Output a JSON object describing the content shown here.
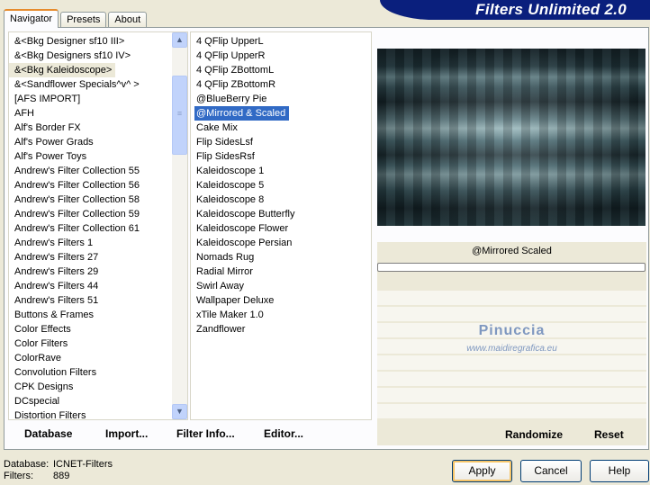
{
  "tabs": [
    "Navigator",
    "Presets",
    "About"
  ],
  "app_title": "Filters Unlimited 2.0",
  "categories": [
    "&<Bkg Designer sf10 III>",
    "&<Bkg Designers sf10 IV>",
    "&<Bkg Kaleidoscope>",
    "&<Sandflower Specials^v^ >",
    "[AFS IMPORT]",
    "AFH",
    "Alf's Border FX",
    "Alf's Power Grads",
    "Alf's Power Toys",
    "Andrew's Filter Collection 55",
    "Andrew's Filter Collection 56",
    "Andrew's Filter Collection 58",
    "Andrew's Filter Collection 59",
    "Andrew's Filter Collection 61",
    "Andrew's Filters 1",
    "Andrew's Filters 27",
    "Andrew's Filters 29",
    "Andrew's Filters 44",
    "Andrew's Filters 51",
    "Buttons & Frames",
    "Color Effects",
    "Color Filters",
    "ColorRave",
    "Convolution Filters",
    "CPK Designs",
    "DCspecial",
    "Distortion Filters"
  ],
  "selected_category": "&<Bkg Kaleidoscope>",
  "filters": [
    "4 QFlip UpperL",
    "4 QFlip UpperR",
    "4 QFlip ZBottomL",
    "4 QFlip ZBottomR",
    "@BlueBerry Pie",
    "@Mirrored & Scaled",
    "Cake Mix",
    "Flip SidesLsf",
    "Flip SidesRsf",
    "Kaleidoscope 1",
    "Kaleidoscope 5",
    "Kaleidoscope 8",
    "Kaleidoscope Butterfly",
    "Kaleidoscope Flower",
    "Kaleidoscope Persian",
    "Nomads Rug",
    "Radial Mirror",
    "Swirl Away",
    "Wallpaper Deluxe",
    "xTile Maker 1.0",
    "Zandflower"
  ],
  "selected_filter": "@Mirrored & Scaled",
  "bottom_links": {
    "database": "Database",
    "import": "Import...",
    "filter_info": "Filter Info...",
    "editor": "Editor..."
  },
  "preview_filter_name": "@Mirrored  Scaled",
  "watermark": {
    "line1": "Pinuccia",
    "line2": "www.maidiregrafica.eu"
  },
  "side_links": {
    "randomize": "Randomize",
    "reset": "Reset"
  },
  "status": {
    "database_label": "Database:",
    "database_value": "ICNET-Filters",
    "filters_label": "Filters:",
    "filters_value": "889"
  },
  "buttons": {
    "apply": "Apply",
    "cancel": "Cancel",
    "help": "Help"
  },
  "icons": {
    "scroll_up": "up-arrow-icon",
    "scroll_down": "down-arrow-icon"
  }
}
